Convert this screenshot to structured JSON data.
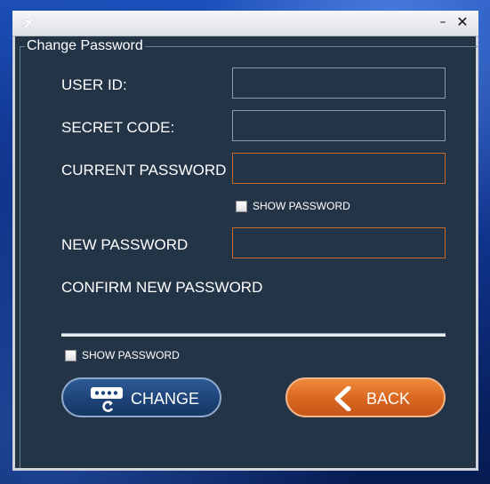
{
  "window": {
    "minimize_glyph": "–",
    "close_glyph": "✕",
    "app_icon": "airplane-icon"
  },
  "group": {
    "title": "Change Password"
  },
  "form": {
    "user_id_label": "USER ID:",
    "secret_code_label": "SECRET CODE:",
    "current_password_label": "CURRENT PASSWORD",
    "new_password_label": "NEW PASSWORD",
    "confirm_password_label": "CONFIRM NEW PASSWORD",
    "user_id_value": "",
    "secret_code_value": "",
    "current_password_value": "",
    "new_password_value": "",
    "confirm_password_value": "",
    "show_password_1": {
      "label": "SHOW PASSWORD",
      "checked": false
    },
    "show_password_2": {
      "label": "SHOW PASSWORD",
      "checked": false
    }
  },
  "buttons": {
    "change_label": "CHANGE",
    "change_icon": "password-refresh-icon",
    "back_label": "BACK",
    "back_icon": "chevron-left-icon"
  },
  "colors": {
    "panel": "#243447",
    "accent_orange": "#d9661e",
    "accent_blue": "#1d4478"
  }
}
